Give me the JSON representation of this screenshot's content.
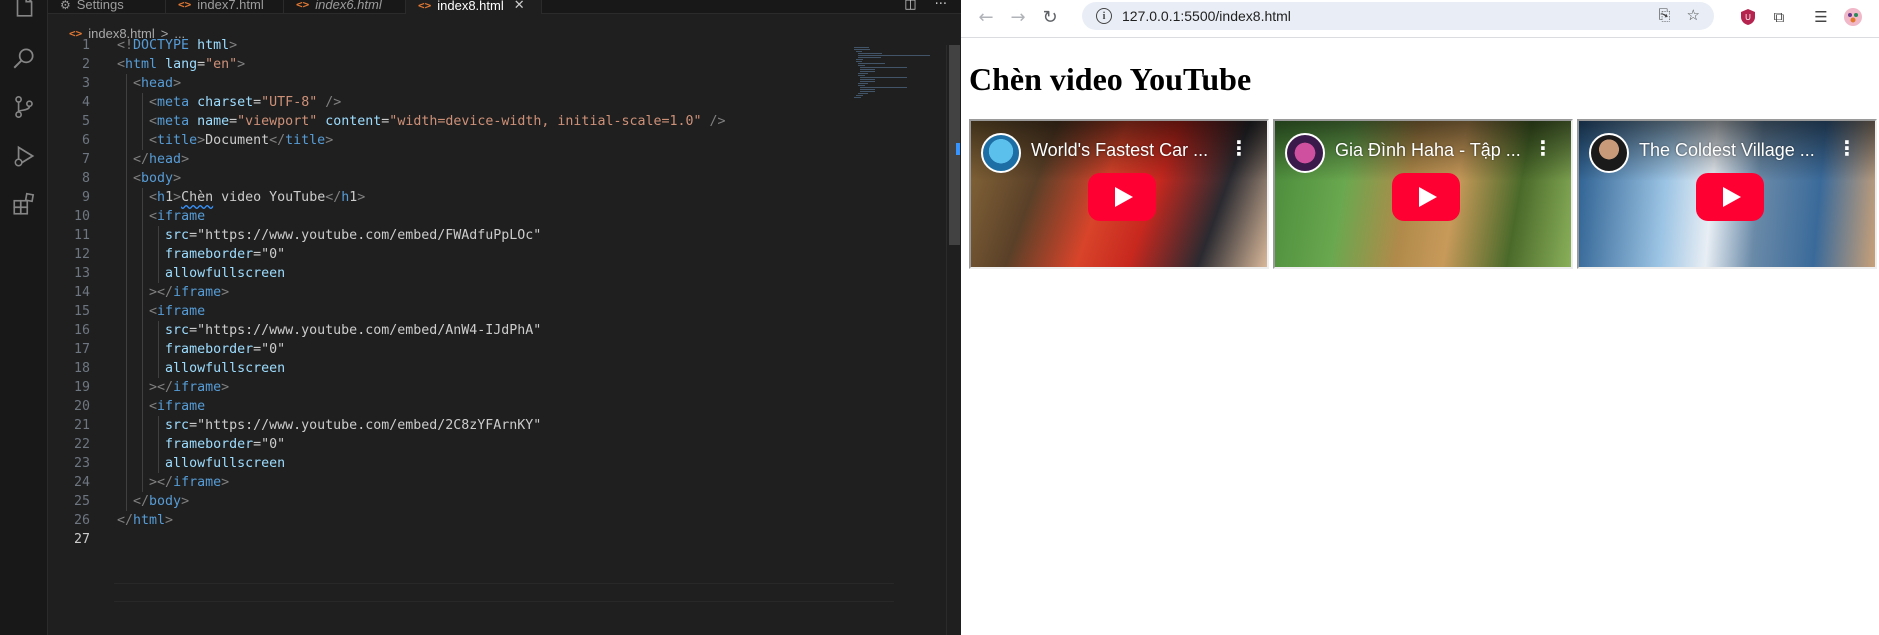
{
  "editor": {
    "tabs": [
      {
        "label": "Settings",
        "icon": "settings-icon",
        "italic": false,
        "active": false
      },
      {
        "label": "index7.html",
        "icon": "html-file-icon",
        "italic": false,
        "active": false
      },
      {
        "label": "index6.html",
        "icon": "html-file-icon",
        "italic": true,
        "active": false
      },
      {
        "label": "index8.html",
        "icon": "html-file-icon",
        "italic": false,
        "active": true
      }
    ],
    "breadcrumb": {
      "file": "index8.html",
      "sep": ">",
      "more": "..."
    },
    "current_line": 27,
    "lines": [
      "<!DOCTYPE html>",
      "<html lang=\"en\">",
      "  <head>",
      "    <meta charset=\"UTF-8\" />",
      "    <meta name=\"viewport\" content=\"width=device-width, initial-scale=1.0\" />",
      "    <title>Document</title>",
      "  </head>",
      "  <body>",
      "    <h1>Chèn video YouTube</h1>",
      "    <iframe",
      "      src=\"https://www.youtube.com/embed/FWAdfuPpLOc\"",
      "      frameborder=\"0\"",
      "      allowfullscreen",
      "    ></iframe>",
      "    <iframe",
      "      src=\"https://www.youtube.com/embed/AnW4-IJdPhA\"",
      "      frameborder=\"0\"",
      "      allowfullscreen",
      "    ></iframe>",
      "    <iframe",
      "      src=\"https://www.youtube.com/embed/2C8zYFArnKY\"",
      "      frameborder=\"0\"",
      "      allowfullscreen",
      "    ></iframe>",
      "  </body>",
      "</html>",
      ""
    ]
  },
  "browser": {
    "url": "127.0.0.1:5500/index8.html",
    "heading": "Chèn video YouTube",
    "videos": [
      {
        "title": "World's Fastest Car ...",
        "accent": "#e05a2a",
        "bg2": "#c8281e"
      },
      {
        "title": "Gia Đình Haha - Tập ...",
        "accent": "#6aa84f",
        "bg2": "#b08a4a"
      },
      {
        "title": "The Coldest Village ...",
        "accent": "#2c7fd0",
        "bg2": "#9cc4e4"
      }
    ]
  },
  "colors": {
    "play": "#ff0033",
    "accent": "#0078d4"
  }
}
